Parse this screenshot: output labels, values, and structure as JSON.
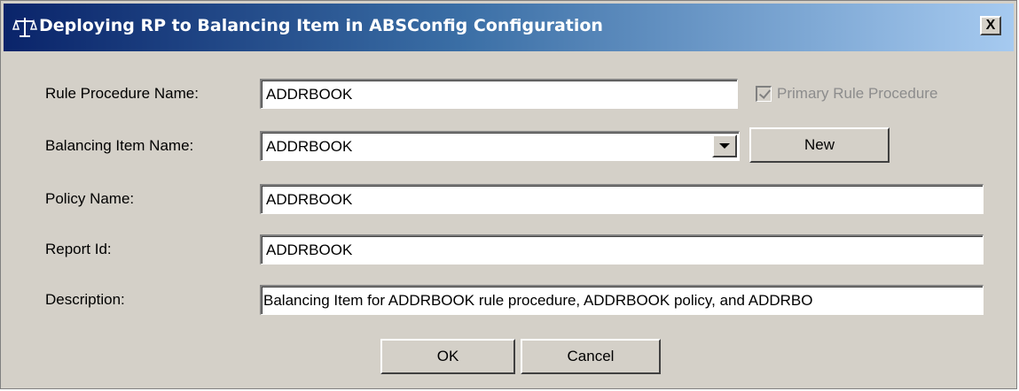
{
  "window": {
    "title": "Deploying RP to Balancing Item in ABSConfig Configuration",
    "close_label": "X",
    "title_icon": "balance-scale-icon"
  },
  "form": {
    "rule_procedure": {
      "label": "Rule Procedure Name:",
      "value": "ADDRBOOK"
    },
    "primary_rule_procedure": {
      "label": "Primary Rule Procedure",
      "checked": true,
      "enabled": false
    },
    "balancing_item": {
      "label": "Balancing Item Name:",
      "value": "ADDRBOOK"
    },
    "new_button": "New",
    "policy": {
      "label": "Policy Name:",
      "value": "ADDRBOOK"
    },
    "report_id": {
      "label": "Report Id:",
      "value": "ADDRBOOK"
    },
    "description": {
      "label": "Description:",
      "value": "Balancing Item for ADDRBOOK rule procedure, ADDRBOOK policy, and ADDRBO"
    }
  },
  "buttons": {
    "ok": "OK",
    "cancel": "Cancel"
  },
  "colors": {
    "face": "#d4d0c8",
    "title_start": "#0a246a",
    "title_end": "#a6caf0",
    "disabled_text": "#8c8c8c"
  }
}
